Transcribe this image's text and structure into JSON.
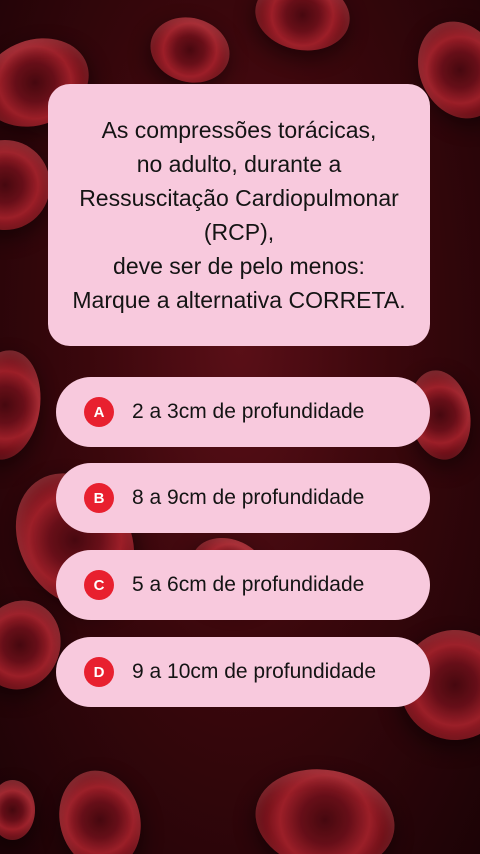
{
  "question": {
    "text": "As compressões torácicas,\nno adulto, durante a\nRessuscitação Cardiopulmonar\n(RCP),\ndeve ser de pelo menos:\nMarque a alternativa CORRETA."
  },
  "options": [
    {
      "letter": "A",
      "text": "2 a 3cm de profundidade"
    },
    {
      "letter": "B",
      "text": "8 a 9cm de profundidade"
    },
    {
      "letter": "C",
      "text": "5 a 6cm de profundidade"
    },
    {
      "letter": "D",
      "text": "9 a 10cm de profundidade"
    }
  ],
  "colors": {
    "card": "#f8c9dd",
    "badge": "#e8202f",
    "background": "#3a070c"
  }
}
